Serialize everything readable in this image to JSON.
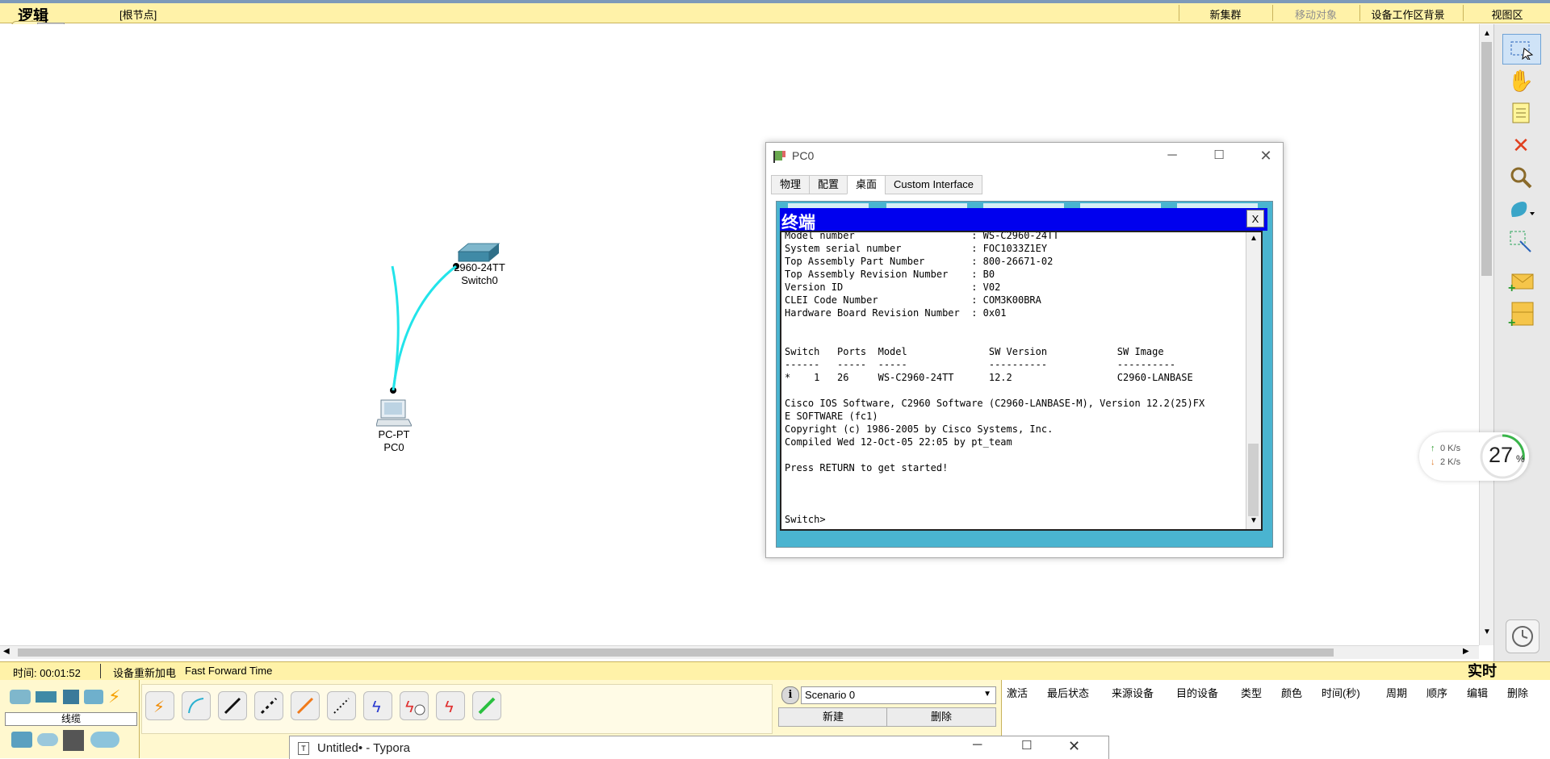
{
  "topbar": {
    "title": "逻辑",
    "root_node": "[根节点]",
    "new_cluster": "新集群",
    "move_object": "移动对象",
    "set_bg": "设备工作区背景",
    "viewport": "视图区"
  },
  "devices": {
    "switch_model": "2960-24TT",
    "switch_name": "Switch0",
    "pc_model": "PC-PT",
    "pc_name": "PC0"
  },
  "pc_window": {
    "title": "PC0",
    "tabs": [
      "物理",
      "配置",
      "桌面",
      "Custom Interface"
    ],
    "active_tab": "桌面",
    "terminal_title": "终端",
    "terminal_close": "X",
    "terminal_lines": [
      "Model number                    : WS-C2960-24TT",
      "System serial number            : FOC1033Z1EY",
      "Top Assembly Part Number        : 800-26671-02",
      "Top Assembly Revision Number    : B0",
      "Version ID                      : V02",
      "CLEI Code Number                : COM3K00BRA",
      "Hardware Board Revision Number  : 0x01",
      "",
      "",
      "Switch   Ports  Model              SW Version            SW Image",
      "------   -----  -----              ----------            ----------",
      "*    1   26     WS-C2960-24TT      12.2                  C2960-LANBASE",
      "",
      "Cisco IOS Software, C2960 Software (C2960-LANBASE-M), Version 12.2(25)FX",
      "E SOFTWARE (fc1)",
      "Copyright (c) 1986-2005 by Cisco Systems, Inc.",
      "Compiled Wed 12-Oct-05 22:05 by pt_team",
      "",
      "Press RETURN to get started!",
      "",
      "",
      "",
      "Switch>"
    ]
  },
  "status": {
    "time": "时间: 00:01:52",
    "power_cycle": "设备重新加电",
    "fast_forward": "Fast Forward Time",
    "realtime": "实时"
  },
  "bottom": {
    "cable_label": "线缆",
    "scenario": "Scenario 0",
    "new_button": "新建",
    "delete_button": "删除",
    "pdu_headers": [
      "激活",
      "最后状态",
      "来源设备",
      "目的设备",
      "类型",
      "颜色",
      "时间(秒)",
      "周期",
      "顺序",
      "编辑",
      "删除"
    ]
  },
  "typora": {
    "title": "Untitled• - Typora"
  },
  "network_widget": {
    "up": "0  K/s",
    "down": "2  K/s",
    "percent": "27",
    "percent_unit": "%"
  }
}
